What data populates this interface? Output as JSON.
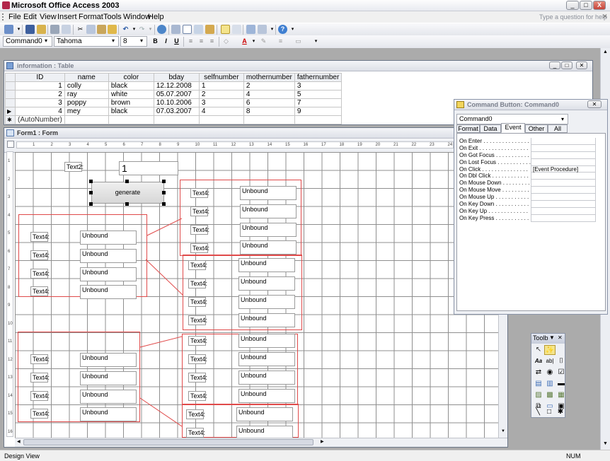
{
  "app": {
    "title": "Microsoft Office Access 2003",
    "help_placeholder": "Type a question for help"
  },
  "menu": [
    "File",
    "Edit",
    "View",
    "Insert",
    "Format",
    "Tools",
    "Window",
    "Help"
  ],
  "formatting": {
    "object": "Command0",
    "font": "Tahoma",
    "size": "8",
    "bold": "B",
    "italic": "I",
    "underline": "U"
  },
  "table_window": {
    "title": "information : Table",
    "columns": [
      "ID",
      "name",
      "color",
      "bday",
      "selfnumber",
      "mothernumber",
      "fathernumber"
    ],
    "rows": [
      [
        "1",
        "colly",
        "black",
        "12.12.2008",
        "1",
        "2",
        "3"
      ],
      [
        "2",
        "ray",
        "white",
        "05.07.2007",
        "2",
        "4",
        "5"
      ],
      [
        "3",
        "poppy",
        "brown",
        "10.10.2006",
        "3",
        "6",
        "7"
      ],
      [
        "4",
        "mey",
        "black",
        "07.03.2007",
        "4",
        "8",
        "9"
      ]
    ],
    "new_row": "(AutoNumber)",
    "current_marker": "▶",
    "new_marker": "✱"
  },
  "form_window": {
    "title": "Form1 : Form",
    "ruler_numbers": [
      "1",
      "2",
      "3",
      "4",
      "5",
      "6",
      "7",
      "8",
      "9",
      "10",
      "11",
      "12",
      "13",
      "14",
      "15",
      "16",
      "17",
      "18",
      "19",
      "20",
      "21",
      "22",
      "23",
      "24"
    ],
    "vruler_numbers": [
      "1",
      "2",
      "3",
      "4",
      "5",
      "6",
      "7",
      "8",
      "9",
      "10",
      "11",
      "12",
      "13",
      "14",
      "15",
      "16"
    ],
    "text2_label": "Text2:",
    "text2_value": "1",
    "generate_button": "generate",
    "text4_label": "Text4:",
    "unbound": "Unbound"
  },
  "property_sheet": {
    "title": "Command Button: Command0",
    "selected_object": "Command0",
    "tabs": [
      "Format",
      "Data",
      "Event",
      "Other",
      "All"
    ],
    "active_tab": "Event",
    "properties": [
      {
        "name": "On Enter . . . . . . . . . . . . . . .",
        "value": ""
      },
      {
        "name": "On Exit . . . . . . . . . . . . . . . .",
        "value": ""
      },
      {
        "name": "On Got Focus . . . . . . . . . . .",
        "value": ""
      },
      {
        "name": "On Lost Focus . . . . . . . . . . .",
        "value": ""
      },
      {
        "name": "On Click . . . . . . . . . . . . . . .",
        "value": "[Event Procedure]"
      },
      {
        "name": "On Dbl Click . . . . . . . . . . . .",
        "value": ""
      },
      {
        "name": "On Mouse Down . . . . . . . . .",
        "value": ""
      },
      {
        "name": "On Mouse Move . . . . . . . . .",
        "value": ""
      },
      {
        "name": "On Mouse Up . . . . . . . . . . .",
        "value": ""
      },
      {
        "name": "On Key Down . . . . . . . . . . .",
        "value": ""
      },
      {
        "name": "On Key Up . . . . . . . . . . . . .",
        "value": ""
      },
      {
        "name": "On Key Press . . . . . . . . . . .",
        "value": ""
      }
    ]
  },
  "toolbox": {
    "title": "Toolb",
    "label_tool": "Aa",
    "text_tool": "ab|"
  },
  "status": {
    "mode": "Design View",
    "num": "NUM"
  },
  "colors": {
    "accent": "#3d6db6",
    "selection_red": "#e04a4a",
    "form_grid": "#8a8a8a"
  }
}
